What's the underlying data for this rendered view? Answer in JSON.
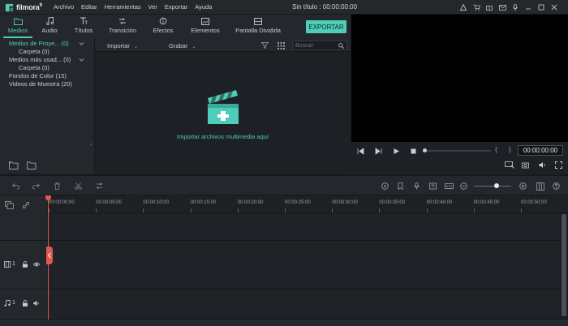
{
  "app": {
    "logo_text": "filmora",
    "logo_version": "9",
    "document_title": "Sin título : 00:00:00:00"
  },
  "menu": [
    "Archivo",
    "Editar",
    "Herramientas",
    "Ver",
    "Exportar",
    "Ayuda"
  ],
  "window_icons": [
    "user-icon",
    "cart-icon",
    "gift-icon",
    "mail-icon",
    "microphone-icon",
    "minimize-icon",
    "maximize-icon",
    "close-icon"
  ],
  "tabs": [
    {
      "label": "Medios",
      "icon": "folder-icon",
      "active": true
    },
    {
      "label": "Audio",
      "icon": "music-note-icon",
      "active": false
    },
    {
      "label": "Títulos",
      "icon": "text-icon",
      "active": false
    },
    {
      "label": "Transición",
      "icon": "transition-icon",
      "active": false
    },
    {
      "label": "Efectos",
      "icon": "effects-icon",
      "active": false
    },
    {
      "label": "Elementos",
      "icon": "image-icon",
      "active": false
    },
    {
      "label": "Pantalla Dividida",
      "icon": "split-screen-icon",
      "active": false
    }
  ],
  "export_label": "EXPORTAR",
  "media_tree": [
    {
      "label": "Medios de Proye... (0)",
      "selected": true,
      "expandable": true,
      "level": 0
    },
    {
      "label": "Carpeta (0)",
      "selected": false,
      "expandable": false,
      "level": 1
    },
    {
      "label": "Medios más usad... (0)",
      "selected": false,
      "expandable": true,
      "level": 0
    },
    {
      "label": "Carpeta (0)",
      "selected": false,
      "expandable": false,
      "level": 1
    },
    {
      "label": "Fondos de Color (15)",
      "selected": false,
      "expandable": false,
      "level": 0
    },
    {
      "label": "Videos de Muestra (20)",
      "selected": false,
      "expandable": false,
      "level": 0
    }
  ],
  "media_toolbar": {
    "import_label": "Importar",
    "record_label": "Grabar",
    "search_placeholder": "Buscar"
  },
  "drop_area_text": "Importar archivos multimedia aquí",
  "preview": {
    "timecode": "00:00:00:00",
    "brackets": "{ }",
    "progress": 0
  },
  "timeline": {
    "zoom_level": 0.6,
    "ruler_ticks": [
      "00:00:00:00",
      "00:00:05:00",
      "00:00:10:00",
      "00:00:15:00",
      "00:00:20:00",
      "00:00:25:00",
      "00:00:30:00",
      "00:00:35:00",
      "00:00:40:00",
      "00:00:45:00",
      "00:00:50:00"
    ],
    "tracks": [
      {
        "type": "video",
        "number": "1"
      },
      {
        "type": "audio",
        "number": "1"
      }
    ]
  },
  "colors": {
    "accent": "#4ecdb8",
    "playhead": "#e2574c",
    "background": "#1a1d21",
    "panel": "#24272c"
  }
}
